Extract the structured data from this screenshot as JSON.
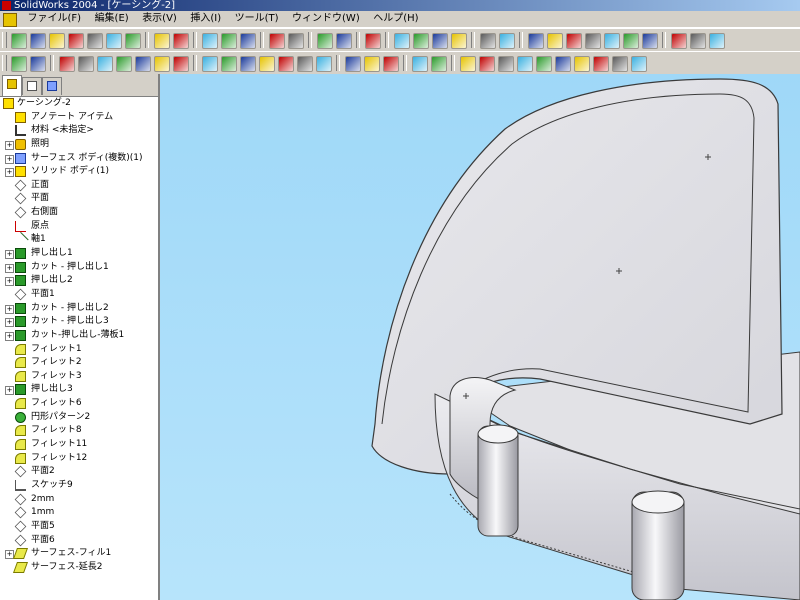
{
  "window": {
    "title": "SolidWorks 2004 - [ケーシング-2]"
  },
  "menu": [
    "ファイル(F)",
    "編集(E)",
    "表示(V)",
    "挿入(I)",
    "ツール(T)",
    "ウィンドウ(W)",
    "ヘルプ(H)"
  ],
  "toolbar1": {
    "icons": [
      "new-icon",
      "open-icon",
      "save-icon",
      "options-icon",
      "rebuild-icon",
      "print-icon",
      "print-preview-icon",
      "sep",
      "undo-icon",
      "redo-icon",
      "sep",
      "select-icon",
      "sketch-icon",
      "smart-dimension-icon",
      "sep",
      "grid-icon",
      "table-icon",
      "sep",
      "relations-icon",
      "verify-icon",
      "sep",
      "help-icon",
      "sep",
      "assembly-icon",
      "mate-icon",
      "3d-sketch-icon",
      "render-icon",
      "sep",
      "move-icon",
      "rotate-icon",
      "sep",
      "zoom-fit-icon",
      "zoom-area-icon",
      "zoom-in-icon",
      "zoom-out-icon",
      "rotate-view-icon",
      "pan-icon",
      "zoom-select-icon",
      "sep",
      "view-orient-icon",
      "hidden-lines-icon",
      "shaded-icon"
    ],
    "colors": {
      "accent": "#c00000",
      "green": "#2a9a2a",
      "blue": "#1a3a9a",
      "yellow": "#e6c300"
    }
  },
  "toolbar2": {
    "icons": [
      "sketch-mode-icon",
      "sketch-line-icon",
      "sep",
      "extrude-icon",
      "revolve-icon",
      "sweep-icon",
      "loft-icon",
      "shell-icon",
      "rib-icon",
      "draft-icon",
      "sep",
      "cut-extrude-icon",
      "cut-revolve-icon",
      "cut-sweep-icon",
      "cut-loft-icon",
      "hole-icon",
      "fillet-icon",
      "chamfer-icon",
      "sep",
      "linear-pattern-icon",
      "circular-pattern-icon",
      "mirror-icon",
      "sep",
      "curve-icon",
      "reference-geometry-icon",
      "sep",
      "surface-extrude-icon",
      "surface-revolve-icon",
      "surface-sweep-icon",
      "surface-loft-icon",
      "offset-surface-icon",
      "fill-surface-icon",
      "extend-surface-icon",
      "trim-surface-icon",
      "knit-icon",
      "planar-surface-icon"
    ]
  },
  "feature_tree": {
    "tabs": [
      "feature-manager-tab",
      "property-manager-tab",
      "configuration-manager-tab"
    ],
    "root": "ケーシング-2",
    "items": [
      {
        "label": "アノテート アイテム",
        "icon": "annotation-icon",
        "expandable": false
      },
      {
        "label": "材料 <未指定>",
        "icon": "material-icon",
        "expandable": false
      },
      {
        "label": "照明",
        "icon": "lighting-icon",
        "expandable": true
      },
      {
        "label": "サーフェス ボディ(複数)(1)",
        "icon": "surface-bodies-icon",
        "expandable": true
      },
      {
        "label": "ソリッド ボディ(1)",
        "icon": "solid-bodies-icon",
        "expandable": true
      },
      {
        "label": "正面",
        "icon": "plane-icon",
        "expandable": false
      },
      {
        "label": "平面",
        "icon": "plane-icon",
        "expandable": false
      },
      {
        "label": "右側面",
        "icon": "plane-icon",
        "expandable": false
      },
      {
        "label": "原点",
        "icon": "origin-icon",
        "expandable": false
      },
      {
        "label": "軸1",
        "icon": "axis-icon",
        "expandable": false
      },
      {
        "label": "押し出し1",
        "icon": "extrude-feature-icon",
        "expandable": true
      },
      {
        "label": "カット - 押し出し1",
        "icon": "cut-extrude-feature-icon",
        "expandable": true
      },
      {
        "label": "押し出し2",
        "icon": "extrude-feature-icon",
        "expandable": true
      },
      {
        "label": "平面1",
        "icon": "plane-icon",
        "expandable": false
      },
      {
        "label": "カット - 押し出し2",
        "icon": "cut-extrude-feature-icon",
        "expandable": true
      },
      {
        "label": "カット - 押し出し3",
        "icon": "cut-extrude-feature-icon",
        "expandable": true
      },
      {
        "label": "カット-押し出し-薄板1",
        "icon": "cut-thin-feature-icon",
        "expandable": true
      },
      {
        "label": "フィレット1",
        "icon": "fillet-feature-icon",
        "expandable": false
      },
      {
        "label": "フィレット2",
        "icon": "fillet-feature-icon",
        "expandable": false
      },
      {
        "label": "フィレット3",
        "icon": "fillet-feature-icon",
        "expandable": false
      },
      {
        "label": "押し出し3",
        "icon": "extrude-feature-icon",
        "expandable": true
      },
      {
        "label": "フィレット6",
        "icon": "fillet-feature-icon",
        "expandable": false
      },
      {
        "label": "円形パターン2",
        "icon": "circular-pattern-feature-icon",
        "expandable": false
      },
      {
        "label": "フィレット8",
        "icon": "fillet-feature-icon",
        "expandable": false
      },
      {
        "label": "フィレット11",
        "icon": "fillet-feature-icon",
        "expandable": false
      },
      {
        "label": "フィレット12",
        "icon": "fillet-feature-icon",
        "expandable": false
      },
      {
        "label": "平面2",
        "icon": "plane-icon",
        "expandable": false
      },
      {
        "label": "スケッチ9",
        "icon": "sketch-feature-icon",
        "expandable": false
      },
      {
        "label": "2mm",
        "icon": "plane-icon",
        "expandable": false
      },
      {
        "label": "1mm",
        "icon": "plane-icon",
        "expandable": false
      },
      {
        "label": "平面5",
        "icon": "plane-icon",
        "expandable": false
      },
      {
        "label": "平面6",
        "icon": "plane-icon",
        "expandable": false
      },
      {
        "label": "サーフェス-フィル1",
        "icon": "surface-fill-feature-icon",
        "expandable": true
      },
      {
        "label": "サーフェス-延長2",
        "icon": "surface-extend-feature-icon",
        "expandable": false
      }
    ]
  },
  "viewport": {
    "background": "#a8dcf8",
    "model": "casing-part-3d-model"
  }
}
